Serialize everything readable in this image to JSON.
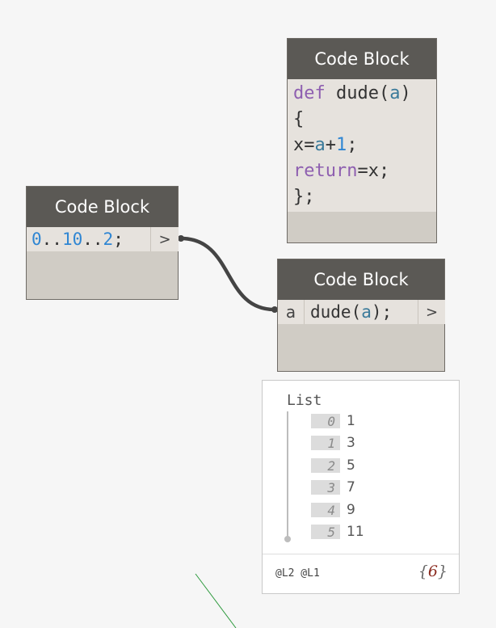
{
  "node_def": {
    "title": "Code Block",
    "lines": [
      {
        "kw1": "def",
        "t1": " dude(",
        "param": "a",
        "t2": ")"
      },
      {
        "t": "{"
      },
      {
        "t1": "x=",
        "param": "a",
        "t2": "+",
        "num": "1",
        "t3": ";"
      },
      {
        "kw": "return",
        "t": "=x;"
      },
      {
        "t": "};"
      }
    ]
  },
  "node_range": {
    "title": "Code Block",
    "code": {
      "n1": "0",
      "d1": "..",
      "n2": "10",
      "d2": "..",
      "n3": "2",
      "end": ";"
    },
    "output_port": ">"
  },
  "node_call": {
    "title": "Code Block",
    "input_port": "a",
    "code": {
      "t1": "dude(",
      "param": "a",
      "t2": ");"
    },
    "output_port": ">"
  },
  "watch": {
    "header": "List",
    "items": [
      {
        "index": "0",
        "value": "1"
      },
      {
        "index": "1",
        "value": "3"
      },
      {
        "index": "2",
        "value": "5"
      },
      {
        "index": "3",
        "value": "7"
      },
      {
        "index": "4",
        "value": "9"
      },
      {
        "index": "5",
        "value": "11"
      }
    ],
    "levels": "@L2 @L1",
    "count_open": "{",
    "count": "6",
    "count_close": "}"
  },
  "colors": {
    "canvas": "#f6f6f6",
    "node_header": "#5b5955",
    "node_body": "#d0ccc5",
    "keyword": "#8e5fb0",
    "number": "#2f86d3",
    "param": "#3a7a9a",
    "wire": "#444444"
  }
}
